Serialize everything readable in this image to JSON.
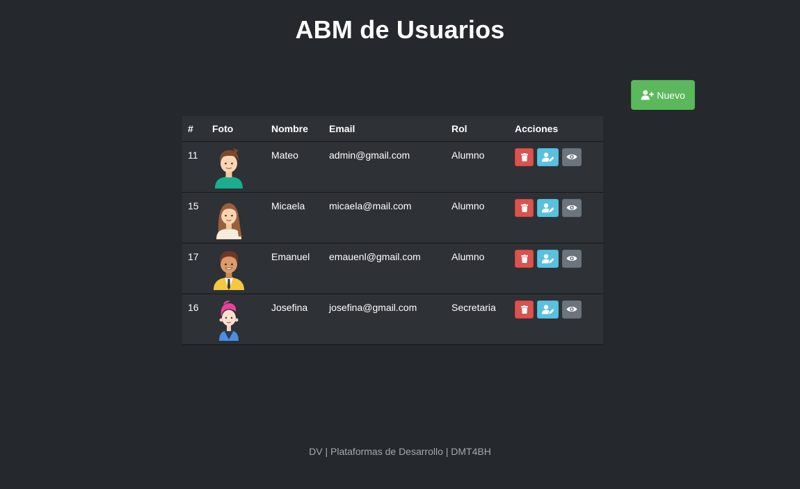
{
  "title": "ABM de Usuarios",
  "new_button": {
    "label": "Nuevo",
    "icon": "user-plus-icon",
    "color": "#5cb85c"
  },
  "table": {
    "headers": [
      "#",
      "Foto",
      "Nombre",
      "Email",
      "Rol",
      "Acciones"
    ],
    "rows": [
      {
        "id": "11",
        "avatar": "male-avatar-teal-shirt",
        "nombre": "Mateo",
        "email": "admin@gmail.com",
        "rol": "Alumno"
      },
      {
        "id": "15",
        "avatar": "female-avatar-long-hair",
        "nombre": "Micaela",
        "email": "micaela@mail.com",
        "rol": "Alumno"
      },
      {
        "id": "17",
        "avatar": "male-avatar-yellow-jacket",
        "nombre": "Emanuel",
        "email": "emauenl@gmail.com",
        "rol": "Alumno"
      },
      {
        "id": "16",
        "avatar": "female-avatar-pink-hair",
        "nombre": "Josefina",
        "email": "josefina@gmail.com",
        "rol": "Secretaria"
      }
    ],
    "actions": [
      {
        "name": "delete",
        "icon": "trash-icon",
        "color": "#d9534f"
      },
      {
        "name": "edit",
        "icon": "user-edit-icon",
        "color": "#5bc0de"
      },
      {
        "name": "view",
        "icon": "eye-icon",
        "color": "#6c757d"
      }
    ]
  },
  "footer": "DV | Plataformas de Desarrollo | DMT4BH"
}
